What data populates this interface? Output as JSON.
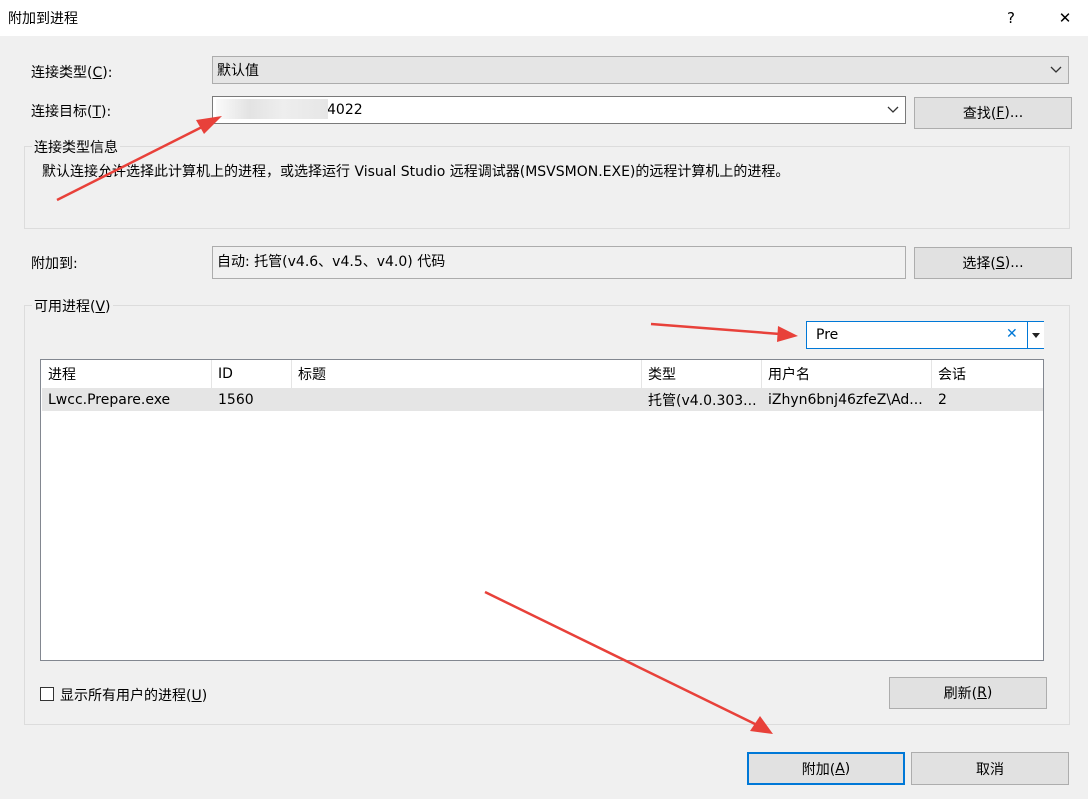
{
  "window": {
    "title": "附加到进程",
    "help_glyph": "?",
    "close_glyph": "✕"
  },
  "connection_type": {
    "label_prefix": "连接类型(",
    "label_key": "C",
    "label_suffix": "):",
    "value": "默认值"
  },
  "connection_target": {
    "label_prefix": "连接目标(",
    "label_key": "T",
    "label_suffix": "):",
    "value": "4022",
    "find_button_prefix": "查找(",
    "find_button_key": "F",
    "find_button_suffix": ")..."
  },
  "connection_info": {
    "group_title": "连接类型信息",
    "text": "默认连接允许选择此计算机上的进程，或选择运行 Visual Studio 远程调试器(MSVSMON.EXE)的远程计算机上的进程。"
  },
  "attach_to": {
    "label": "附加到:",
    "value": "自动: 托管(v4.6、v4.5、v4.0) 代码",
    "select_button_prefix": "选择(",
    "select_button_key": "S",
    "select_button_suffix": ")..."
  },
  "available_processes": {
    "group_title_prefix": "可用进程(",
    "group_title_key": "V",
    "group_title_suffix": ")",
    "filter_value": "Pre",
    "clear_glyph": "✕",
    "columns": [
      "进程",
      "ID",
      "标题",
      "类型",
      "用户名",
      "会话"
    ],
    "rows": [
      {
        "process": "Lwcc.Prepare.exe",
        "id": "1560",
        "title": "",
        "type": "托管(v4.0.303...",
        "user": "iZhyn6bnj46zfeZ\\Ad...",
        "session": "2"
      }
    ],
    "show_all_users_prefix": "显示所有用户的进程(",
    "show_all_users_key": "U",
    "show_all_users_suffix": ")",
    "show_all_users_checked": false,
    "refresh_prefix": "刷新(",
    "refresh_key": "R",
    "refresh_suffix": ")"
  },
  "footer": {
    "attach_prefix": "附加(",
    "attach_key": "A",
    "attach_suffix": ")",
    "cancel": "取消"
  },
  "colors": {
    "accent": "#0078d7",
    "arrow": "#e8413a",
    "window_bg": "#f0f0f0"
  }
}
